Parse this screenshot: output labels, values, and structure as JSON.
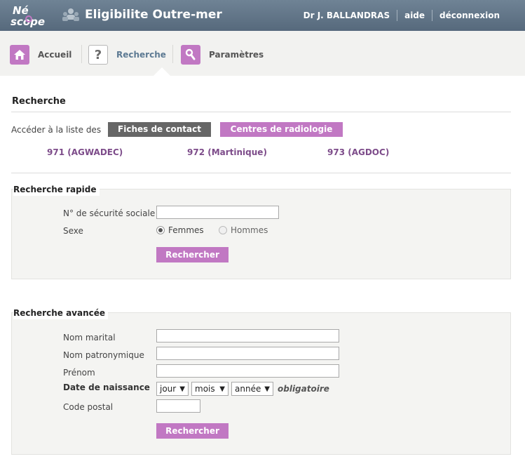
{
  "header": {
    "logo_text": "NéoScope",
    "app_title": "Eligibilite Outre-mer",
    "user": "Dr J. BALLANDRAS",
    "help": "aide",
    "logout": "déconnexion"
  },
  "nav": {
    "items": [
      {
        "label": "Accueil",
        "icon": "home-icon"
      },
      {
        "label": "Recherche",
        "icon": "question-icon"
      },
      {
        "label": "Paramètres",
        "icon": "wrench-icon"
      }
    ],
    "active": "Recherche"
  },
  "search": {
    "title": "Recherche",
    "access_label": "Accéder à la liste des",
    "btn_contacts": "Fiches de contact",
    "btn_radiology": "Centres de radiologie",
    "regions": [
      "971 (AGWADEC)",
      "972 (Martinique)",
      "973 (AGDOC)"
    ]
  },
  "quick": {
    "legend": "Recherche rapide",
    "ssn_label": "N° de sécurité sociale",
    "ssn_value": "",
    "sex_label": "Sexe",
    "sex_options": [
      "Femmes",
      "Hommes"
    ],
    "sex_selected": "Femmes",
    "submit": "Rechercher"
  },
  "advanced": {
    "legend": "Recherche avancée",
    "marital_label": "Nom marital",
    "marital_value": "",
    "birthname_label": "Nom patronymique",
    "birthname_value": "",
    "firstname_label": "Prénom",
    "firstname_value": "",
    "birthdate_label": "Date de naissance",
    "day": "jour",
    "month": "mois",
    "year": "année",
    "mandatory": "obligatoire",
    "postal_label": "Code postal",
    "postal_value": "",
    "submit": "Rechercher"
  },
  "colors": {
    "header_bg": "#627688",
    "accent_purple": "#c178c3",
    "dark_button": "#666666",
    "link_purple": "#7d4c8a",
    "nav_bg": "#f2f2f0"
  }
}
